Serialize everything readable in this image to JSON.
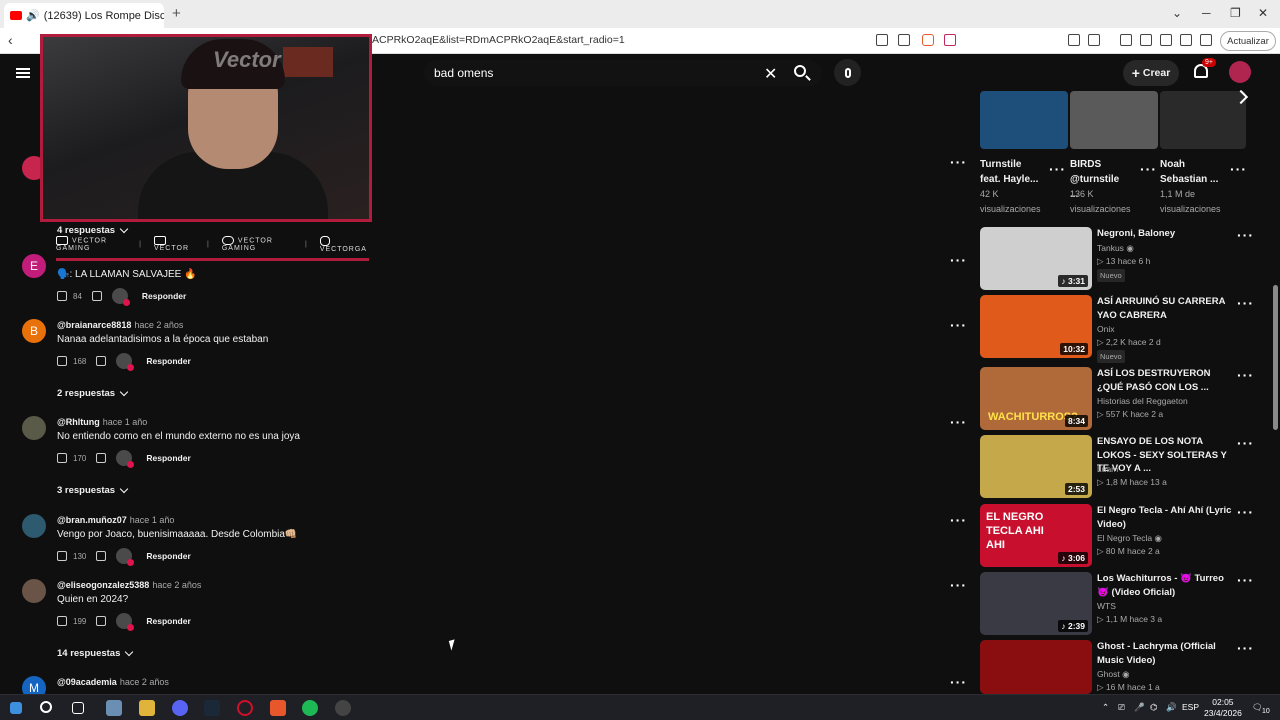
{
  "browser": {
    "tab_title": "(12639) Los Rompe Discotek...",
    "url_visible": "ACPRkO2aqE&list=RDmACPRkO2aqE&start_radio=1",
    "update_button": "Actualizar"
  },
  "header": {
    "search_value": "bad omens",
    "create_label": "Crear",
    "notif_badge": "9+"
  },
  "overlay": {
    "watermark": "Vector",
    "socials": [
      {
        "label": "VECTOR GAMING",
        "icon": "youtube-icon"
      },
      {
        "label": "VECTOR",
        "icon": "twitch-icon"
      },
      {
        "label": "VECTOR GAMING",
        "icon": "twitter-icon"
      },
      {
        "label": "VECTORGA",
        "icon": "instagram-icon"
      }
    ]
  },
  "comments": [
    {
      "replies": "4 respuestas"
    },
    {
      "initial": "E",
      "author": "",
      "time": "",
      "text": "🗣️: LA LLAMAN SALVAJEE 🔥",
      "likes": "84",
      "reply": "Responder"
    },
    {
      "initial": "B",
      "author": "@braianarce8818",
      "time": "hace 2 años",
      "text": "Nanaa adelantadisimos a la época que estaban",
      "likes": "168",
      "reply": "Responder",
      "replies": "2 respuestas"
    },
    {
      "initial": "",
      "author": "@Rhltung",
      "time": "hace 1 año",
      "text": "No entiendo como en el mundo externo no es una joya",
      "likes": "170",
      "reply": "Responder",
      "replies": "3 respuestas"
    },
    {
      "initial": "",
      "author": "@bran.muñoz07",
      "time": "hace 1 año",
      "text": "Vengo por Joaco, buenisimaaaaa. Desde Colombia👊🏼",
      "likes": "130",
      "reply": "Responder"
    },
    {
      "initial": "",
      "author": "@eliseogonzalez5388",
      "time": "hace 2 años",
      "text": "Quien en 2024?",
      "likes": "199",
      "reply": "Responder",
      "replies": "14 respuestas"
    },
    {
      "initial": "M",
      "author": "@09academia",
      "time": "hace 2 años"
    }
  ],
  "shelf": [
    {
      "title": "Turnstile feat. Hayle...",
      "views": "42 K",
      "views_label": "visualizaciones",
      "color": "#1d4f7a"
    },
    {
      "title": "BIRDS @turnstile ...",
      "views": "136 K",
      "views_label": "visualizaciones",
      "color": "#5a5a5a"
    },
    {
      "title": "Noah Sebastian ...",
      "views": "1,1 M de",
      "views_label": "visualizaciones",
      "color": "#2a2a2a"
    }
  ],
  "recommendations": [
    {
      "title": "Negroni, Baloney",
      "channel": "Tankus",
      "verified": true,
      "meta": "▷ 13  hace 6 h",
      "duration": "♪ 3:31",
      "nuevo": "Nuevo",
      "color": "#cfcfcf"
    },
    {
      "title": "ASÍ ARRUINÓ SU CARRERA YAO CABRERA",
      "channel": "Onix",
      "verified": false,
      "meta": "▷ 2,2 K  hace 2 d",
      "duration": "10:32",
      "nuevo": "Nuevo",
      "color": "#e05a1c"
    },
    {
      "title": "ASÍ LOS DESTRUYERON ¿QUÉ PASÓ CON LOS ...",
      "channel": "Historias del Reggaeton",
      "verified": false,
      "meta": "▷ 557 K  hace 2 a",
      "duration": "8:34",
      "thumb_text": "WACHITURROS?",
      "color": "#b06a3a"
    },
    {
      "title": "ENSAYO DE LOS NOTA LOKOS - SEXY SOLTERAS Y TE VOY A ...",
      "channel": "Luam",
      "verified": false,
      "meta": "▷ 1,8 M  hace 13 a",
      "duration": "2:53",
      "color": "#c4a84a"
    },
    {
      "title": "El Negro Tecla - Ahí Ahí (Lyric Video)",
      "channel": "El Negro Tecla",
      "verified": true,
      "meta": "▷ 80 M  hace 2 a",
      "duration": "♪ 3:06",
      "thumb_text": "EL NEGRO TECLA AHI AHI",
      "color": "#c8102e"
    },
    {
      "title": "Los Wachiturros - 😈 Turreo 😈 (Video Oficial)",
      "channel": "WTS",
      "verified": false,
      "meta": "▷ 1,1 M  hace 3 a",
      "duration": "♪ 2:39",
      "color": "#3a3a44"
    },
    {
      "title": "Ghost - Lachryma (Official Music Video)",
      "channel": "Ghost",
      "verified": true,
      "meta": "▷ 16 M  hace 1 a",
      "duration": "",
      "color": "#8a0e10"
    }
  ],
  "taskbar": {
    "time": "02:05",
    "date": "23/4/2026",
    "lang": "ESP",
    "notif": "10"
  }
}
